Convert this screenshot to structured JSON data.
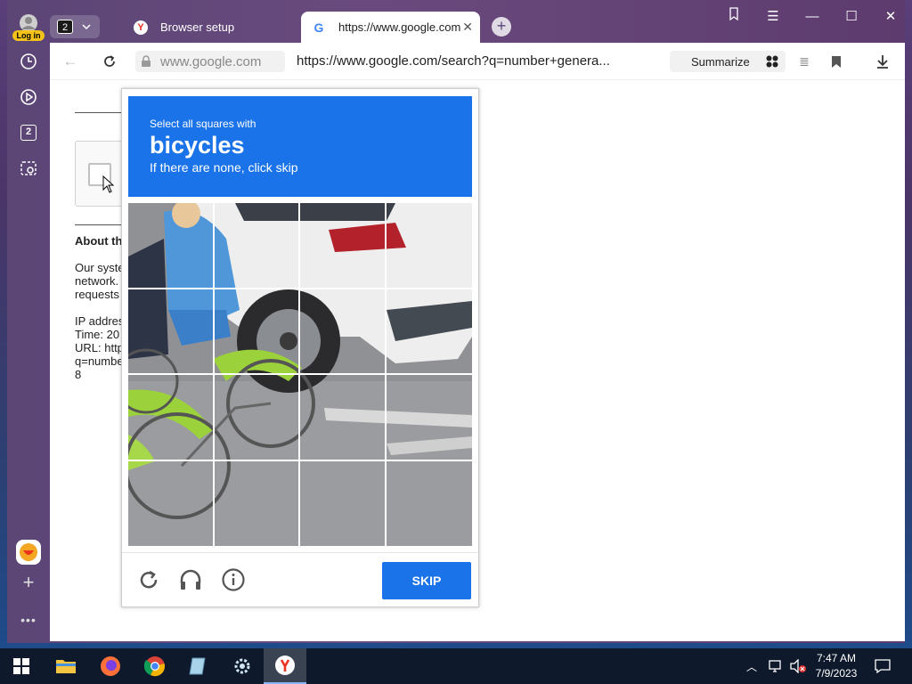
{
  "sidebar": {
    "login_label": "Log in",
    "tab_count": "2"
  },
  "tabs": {
    "counter": "2",
    "items": [
      {
        "label": "Browser setup",
        "favicon": "yandex-icon",
        "active": false
      },
      {
        "label": "https://www.google.com",
        "favicon": "google-icon",
        "active": true
      }
    ]
  },
  "toolbar": {
    "domain": "www.google.com",
    "url": "https://www.google.com/search?q=number+genera...",
    "summarize_label": "Summarize"
  },
  "page": {
    "about_heading": "About th",
    "body_lines": [
      "Our syste",
      "network.",
      "requests"
    ],
    "ip_lines": [
      "IP addres",
      "Time: 20",
      "URL: http",
      "q=numbe",
      "8"
    ]
  },
  "captcha": {
    "instruction_small": "Select all squares with",
    "instruction_target": "bicycles",
    "instruction_sub": "If there are none, click skip",
    "skip_label": "SKIP",
    "grid_size": 4
  },
  "taskbar": {
    "apps": [
      "start-icon",
      "file-explorer-icon",
      "firefox-icon",
      "chrome-icon",
      "notepad-icon",
      "settings-icon",
      "yandex-browser-icon"
    ],
    "time": "7:47 AM",
    "date": "7/9/2023"
  },
  "colors": {
    "captcha_blue": "#1a73e8",
    "browser_frame": "#5b4676",
    "taskbar": "#0e1a2b"
  }
}
